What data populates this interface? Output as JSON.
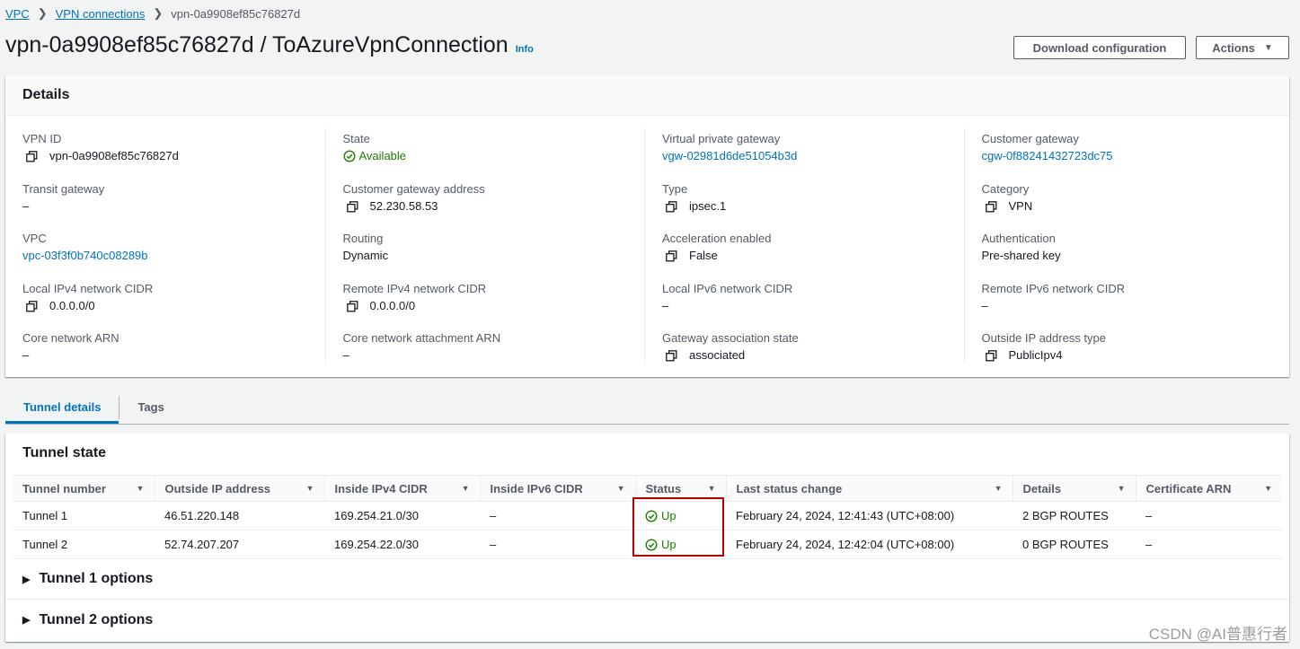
{
  "breadcrumb": {
    "items": [
      "VPC",
      "VPN connections"
    ],
    "current": "vpn-0a9908ef85c76827d"
  },
  "header": {
    "title": "vpn-0a9908ef85c76827d / ToAzureVpnConnection",
    "info": "Info",
    "download_label": "Download configuration",
    "actions_label": "Actions"
  },
  "details": {
    "title": "Details",
    "columns": [
      [
        {
          "label": "VPN ID",
          "value": "vpn-0a9908ef85c76827d",
          "copy": true
        },
        {
          "label": "Transit gateway",
          "value": "–"
        },
        {
          "label": "VPC",
          "value": "vpc-03f3f0b740c08289b",
          "link": true
        },
        {
          "label": "Local IPv4 network CIDR",
          "value": "0.0.0.0/0",
          "copy": true
        },
        {
          "label": "Core network ARN",
          "value": "–"
        }
      ],
      [
        {
          "label": "State",
          "value": "Available",
          "status": true
        },
        {
          "label": "Customer gateway address",
          "value": "52.230.58.53",
          "copy": true
        },
        {
          "label": "Routing",
          "value": "Dynamic"
        },
        {
          "label": "Remote IPv4 network CIDR",
          "value": "0.0.0.0/0",
          "copy": true
        },
        {
          "label": "Core network attachment ARN",
          "value": "–"
        }
      ],
      [
        {
          "label": "Virtual private gateway",
          "value": "vgw-02981d6de51054b3d",
          "link": true
        },
        {
          "label": "Type",
          "value": "ipsec.1",
          "copy": true
        },
        {
          "label": "Acceleration enabled",
          "value": "False",
          "copy": true
        },
        {
          "label": "Local IPv6 network CIDR",
          "value": "–"
        },
        {
          "label": "Gateway association state",
          "value": "associated",
          "copy": true
        }
      ],
      [
        {
          "label": "Customer gateway",
          "value": "cgw-0f88241432723dc75",
          "link": true
        },
        {
          "label": "Category",
          "value": "VPN",
          "copy": true
        },
        {
          "label": "Authentication",
          "value": "Pre-shared key"
        },
        {
          "label": "Remote IPv6 network CIDR",
          "value": "–"
        },
        {
          "label": "Outside IP address type",
          "value": "PublicIpv4",
          "copy": true
        }
      ]
    ]
  },
  "tabs": [
    {
      "label": "Tunnel details",
      "active": true
    },
    {
      "label": "Tags",
      "active": false
    }
  ],
  "tunnel_state": {
    "title": "Tunnel state",
    "columns": [
      "Tunnel number",
      "Outside IP address",
      "Inside IPv4 CIDR",
      "Inside IPv6 CIDR",
      "Status",
      "Last status change",
      "Details",
      "Certificate ARN"
    ],
    "rows": [
      [
        "Tunnel 1",
        "46.51.220.148",
        "169.254.21.0/30",
        "–",
        "Up",
        "February 24, 2024, 12:41:43 (UTC+08:00)",
        "2 BGP ROUTES",
        "–"
      ],
      [
        "Tunnel 2",
        "52.74.207.207",
        "169.254.22.0/30",
        "–",
        "Up",
        "February 24, 2024, 12:42:04 (UTC+08:00)",
        "0 BGP ROUTES",
        "–"
      ]
    ]
  },
  "expanders": [
    "Tunnel 1 options",
    "Tunnel 2 options"
  ],
  "watermark": "CSDN @AI普惠行者",
  "colors": {
    "link": "#0073bb",
    "success": "#1d8102",
    "highlight": "#b20000"
  }
}
